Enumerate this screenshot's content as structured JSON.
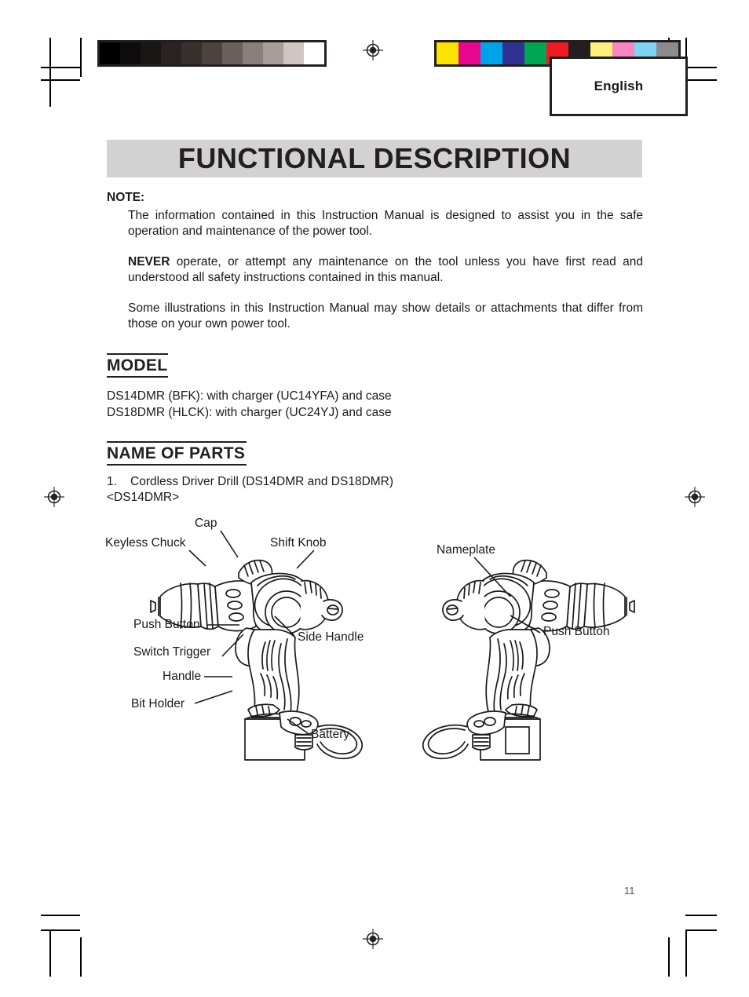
{
  "header": {
    "language_label": "English",
    "title": "FUNCTIONAL DESCRIPTION"
  },
  "note": {
    "label": "NOTE:",
    "paragraph_1": "The information contained in this Instruction Manual is designed to assist you in the safe operation and maintenance of the power tool.",
    "paragraph_2_strong": "NEVER",
    "paragraph_2_rest": " operate, or attempt any maintenance on the tool unless you have first read and understood all safety instructions contained in this manual.",
    "paragraph_3": "Some illustrations in this Instruction Manual may show details or attachments that differ from those on your own power tool."
  },
  "model": {
    "heading": "MODEL",
    "line_1": "DS14DMR (BFK):  with charger (UC14YFA) and case",
    "line_2": "DS18DMR (HLCK):  with charger (UC24YJ) and case"
  },
  "name_of_parts": {
    "heading": "NAME OF PARTS",
    "item_number": "1.",
    "item_title": "Cordless Driver Drill (DS14DMR and DS18DMR)",
    "variant": "<DS14DMR>"
  },
  "figure_left": {
    "labels": {
      "cap": "Cap",
      "keyless_chuck": "Keyless Chuck",
      "shift_knob": "Shift Knob",
      "push_button": "Push Button",
      "switch_trigger": "Switch Trigger",
      "side_handle": "Side Handle",
      "handle": "Handle",
      "bit_holder": "Bit Holder",
      "battery": "Battery"
    }
  },
  "figure_right": {
    "labels": {
      "nameplate": "Nameplate",
      "push_button": "Push Button"
    }
  },
  "footer": {
    "page_number": "11"
  },
  "calibration": {
    "grayscale_swatches": [
      "#000000",
      "#0d0b0b",
      "#1a1615",
      "#2a2321",
      "#38302c",
      "#4c423e",
      "#6b605b",
      "#8a7f7a",
      "#a79d99",
      "#cfc6c3",
      "#ffffff"
    ],
    "color_swatches": [
      "#fde300",
      "#e8068f",
      "#00a2e8",
      "#2e3192",
      "#00a651",
      "#ed1c24",
      "#231f20",
      "#fdf07c",
      "#f886c0",
      "#7fd4f4",
      "#8c8c8c"
    ]
  },
  "colors": {
    "banner_background": "#d2d2d2",
    "ink": "#231f20"
  }
}
